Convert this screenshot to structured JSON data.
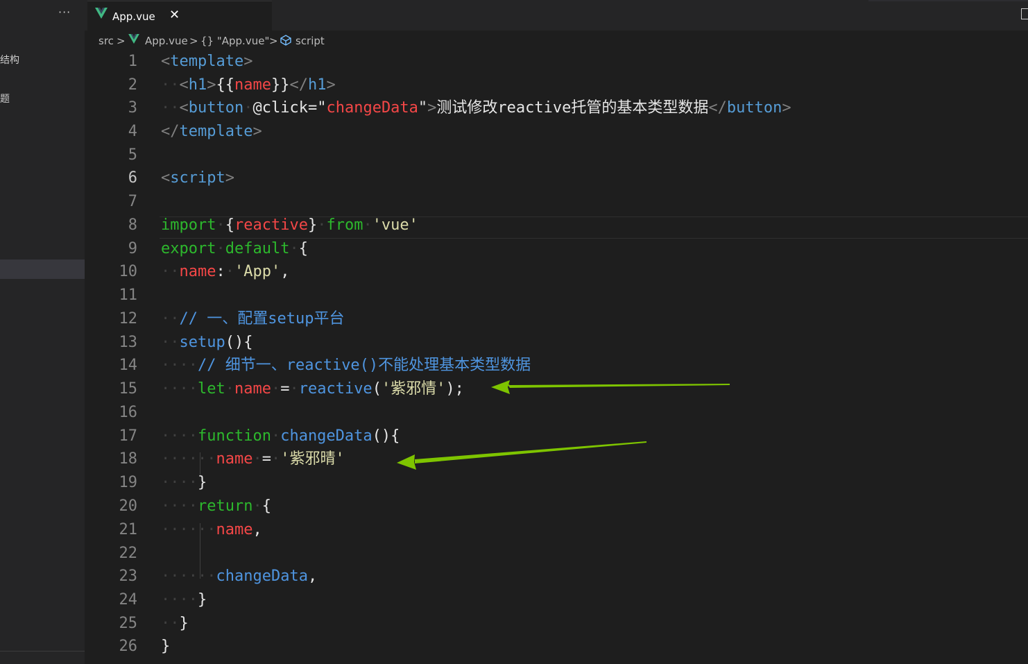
{
  "sidebar": {
    "more_label": "···",
    "items": [
      "结构",
      "题"
    ]
  },
  "tab": {
    "title": "App.vue",
    "close": "✕"
  },
  "breadcrumb": {
    "parts": [
      "src",
      "App.vue",
      "{} \"App.vue\"",
      "script"
    ],
    "separator": ">"
  },
  "editor": {
    "active_line": 6,
    "lines": [
      {
        "n": "1"
      },
      {
        "n": "2"
      },
      {
        "n": "3"
      },
      {
        "n": "4"
      },
      {
        "n": "5"
      },
      {
        "n": "6"
      },
      {
        "n": "7"
      },
      {
        "n": "8"
      },
      {
        "n": "9"
      },
      {
        "n": "10"
      },
      {
        "n": "11"
      },
      {
        "n": "12"
      },
      {
        "n": "13"
      },
      {
        "n": "14"
      },
      {
        "n": "15"
      },
      {
        "n": "16"
      },
      {
        "n": "17"
      },
      {
        "n": "18"
      },
      {
        "n": "19"
      },
      {
        "n": "20"
      },
      {
        "n": "21"
      },
      {
        "n": "22"
      },
      {
        "n": "23"
      },
      {
        "n": "24"
      },
      {
        "n": "25"
      },
      {
        "n": "26"
      }
    ],
    "tokens": {
      "template": "template",
      "h1": "h1",
      "name": "name",
      "button": "button",
      "click_attr": "@click",
      "changeData": "changeData",
      "button_text": "测试修改reactive托管的基本类型数据",
      "script": "script",
      "import": "import",
      "reactive": "reactive",
      "from": "from",
      "vue_str": "'vue'",
      "export": "export",
      "default": "default",
      "app_str": "'App'",
      "comment1": "// 一、配置setup平台",
      "setup": "setup",
      "comment2": "// 细节一、reactive()不能处理基本类型数据",
      "let": "let",
      "str1": "'紫邪情'",
      "function": "function",
      "str2": "'紫邪晴'",
      "return": "return"
    }
  },
  "colors": {
    "background": "#1e1e1e",
    "sidebar": "#252526",
    "arrow": "#7ec400",
    "vue_logo": "#41b883"
  }
}
